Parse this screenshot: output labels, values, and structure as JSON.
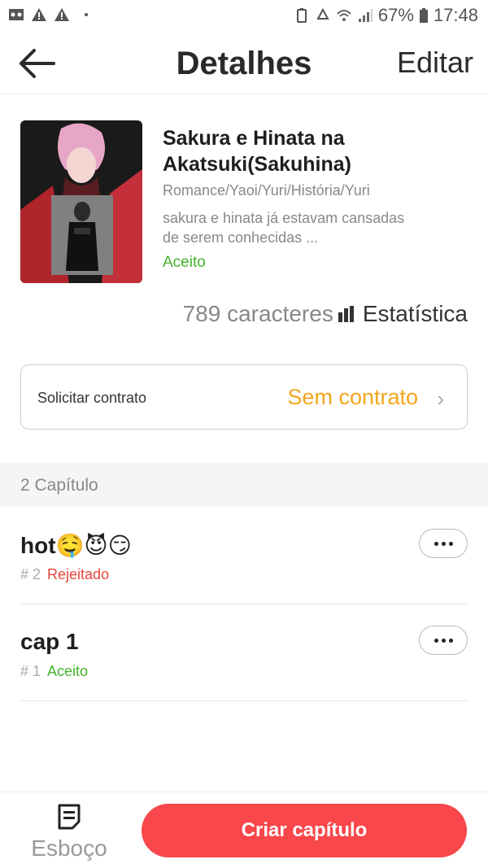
{
  "status_bar": {
    "battery": "67%",
    "time": "17:48"
  },
  "header": {
    "title": "Detalhes",
    "edit_label": "Editar"
  },
  "book": {
    "title": "Sakura e Hinata na Akatsuki(Sakuhina)",
    "genres": "Romance/Yaoi/Yuri/História/Yuri",
    "description": "sakura e hinata já estavam cansadas de serem conhecidas ...",
    "status": "Aceito",
    "characters": "789 caracteres",
    "stats_label": "Estatística"
  },
  "contract": {
    "label": "Solicitar contrato",
    "value": "Sem contrato"
  },
  "chapters": {
    "header": "2 Capítulo",
    "items": [
      {
        "title": "hot🤤😈😏",
        "number": "# 2",
        "status": "Rejeitado"
      },
      {
        "title": "cap 1",
        "number": "# 1",
        "status": "Aceito"
      }
    ]
  },
  "bottom": {
    "draft_label": "Esboço",
    "create_label": "Criar capítulo"
  },
  "colors": {
    "accent": "#f9474c",
    "accepted": "#45b32c",
    "rejected": "#e8453c",
    "contract": "#f2a61c"
  }
}
